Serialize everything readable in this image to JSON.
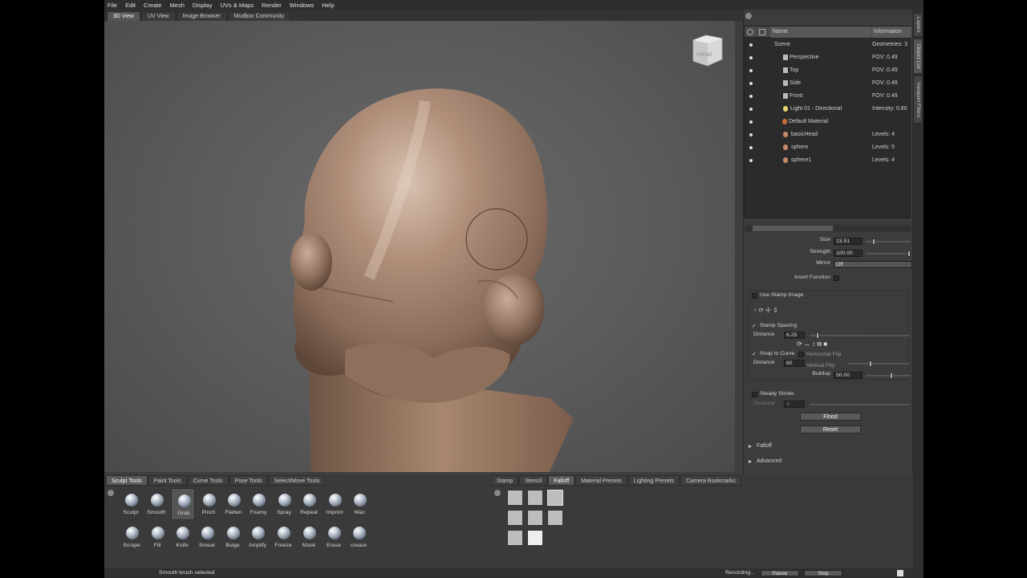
{
  "menu": [
    "File",
    "Edit",
    "Create",
    "Mesh",
    "Display",
    "UVs & Maps",
    "Render",
    "Windows",
    "Help"
  ],
  "view_tabs": [
    {
      "label": "3D View",
      "active": true
    },
    {
      "label": "UV View",
      "active": false
    },
    {
      "label": "Image Browser",
      "active": false
    },
    {
      "label": "Mudbox Community",
      "active": false
    }
  ],
  "nav_cube_label": "FRONT",
  "side_tabs": [
    "Layers",
    "Object List",
    "Viewport Filters"
  ],
  "object_list": {
    "col_name": "Name",
    "col_info": "Information",
    "rows": [
      {
        "name": "Scene",
        "info": "Geometries: 3",
        "icon": "tree"
      },
      {
        "name": "Perspective",
        "info": "FOV: 0.49",
        "icon": "camera"
      },
      {
        "name": "Top",
        "info": "FOV: 0.49",
        "icon": "camera"
      },
      {
        "name": "Side",
        "info": "FOV: 0.49",
        "icon": "camera"
      },
      {
        "name": "Front",
        "info": "FOV: 0.49",
        "icon": "camera"
      },
      {
        "name": "Light 01 - Directional",
        "info": "Intensity: 0.80",
        "icon": "light"
      },
      {
        "name": "Default Material",
        "info": "",
        "icon": "material"
      },
      {
        "name": "basicHead",
        "info": "Levels: 4",
        "icon": "mesh"
      },
      {
        "name": "sphere",
        "info": "Levels: 5",
        "icon": "mesh"
      },
      {
        "name": "sphere1",
        "info": "Levels: 4",
        "icon": "mesh"
      }
    ]
  },
  "properties": {
    "size_label": "Size",
    "size_value": "13.51",
    "strength_label": "Strength",
    "strength_value": "100.00",
    "mirror_label": "Mirror",
    "mirror_value": "Off",
    "invert_label": "Invert Function",
    "use_stamp_label": "Use Stamp Image",
    "stamp_spacing_label": "Stamp Spacing",
    "distance_label": "Distance",
    "distance_value": "6.25",
    "snap_curve_label": "Snap to Curve",
    "distance2_label": "Distance",
    "distance2_value": "60",
    "horizontal_flip_label": "Horizontal Flip",
    "vertical_flip_label": "Vertical Flip",
    "buildup_label": "Buildup",
    "buildup_value": "50.00",
    "steady_label": "Steady Stroke",
    "distance3_label": "Distance",
    "distance3_value": "4",
    "flood_label": "Flood",
    "reset_label": "Reset",
    "falloff_section": "Falloff",
    "advanced_section": "Advanced"
  },
  "tool_tabs": [
    {
      "label": "Sculpt Tools",
      "active": true
    },
    {
      "label": "Paint Tools",
      "active": false
    },
    {
      "label": "Curve Tools",
      "active": false
    },
    {
      "label": "Pose Tools",
      "active": false
    },
    {
      "label": "Select/Move Tools",
      "active": false
    }
  ],
  "tools_row1": [
    "Sculpt",
    "Smooth",
    "Grab",
    "Pinch",
    "Flatten",
    "Foamy",
    "Spray",
    "Repeat",
    "Imprint",
    "Wax"
  ],
  "tools_row2": [
    "Scrape",
    "Fill",
    "Knife",
    "Smear",
    "Bulge",
    "Amplify",
    "Freeze",
    "Mask",
    "Erase",
    "crease"
  ],
  "selected_tool": "Grab",
  "tray_tabs": [
    {
      "label": "Stamp",
      "active": false
    },
    {
      "label": "Stencil",
      "active": false
    },
    {
      "label": "Falloff",
      "active": true
    },
    {
      "label": "Material Presets",
      "active": false
    },
    {
      "label": "Lighting Presets",
      "active": false
    },
    {
      "label": "Camera Bookmarks",
      "active": false
    }
  ],
  "status": {
    "message": "Smooth brush selected",
    "recording": "Recording...",
    "pause": "Pause",
    "stop": "Stop"
  },
  "colors": {
    "accent": "#5a5a5a",
    "bg": "#3e3e3e",
    "clay": "#a88a76"
  }
}
